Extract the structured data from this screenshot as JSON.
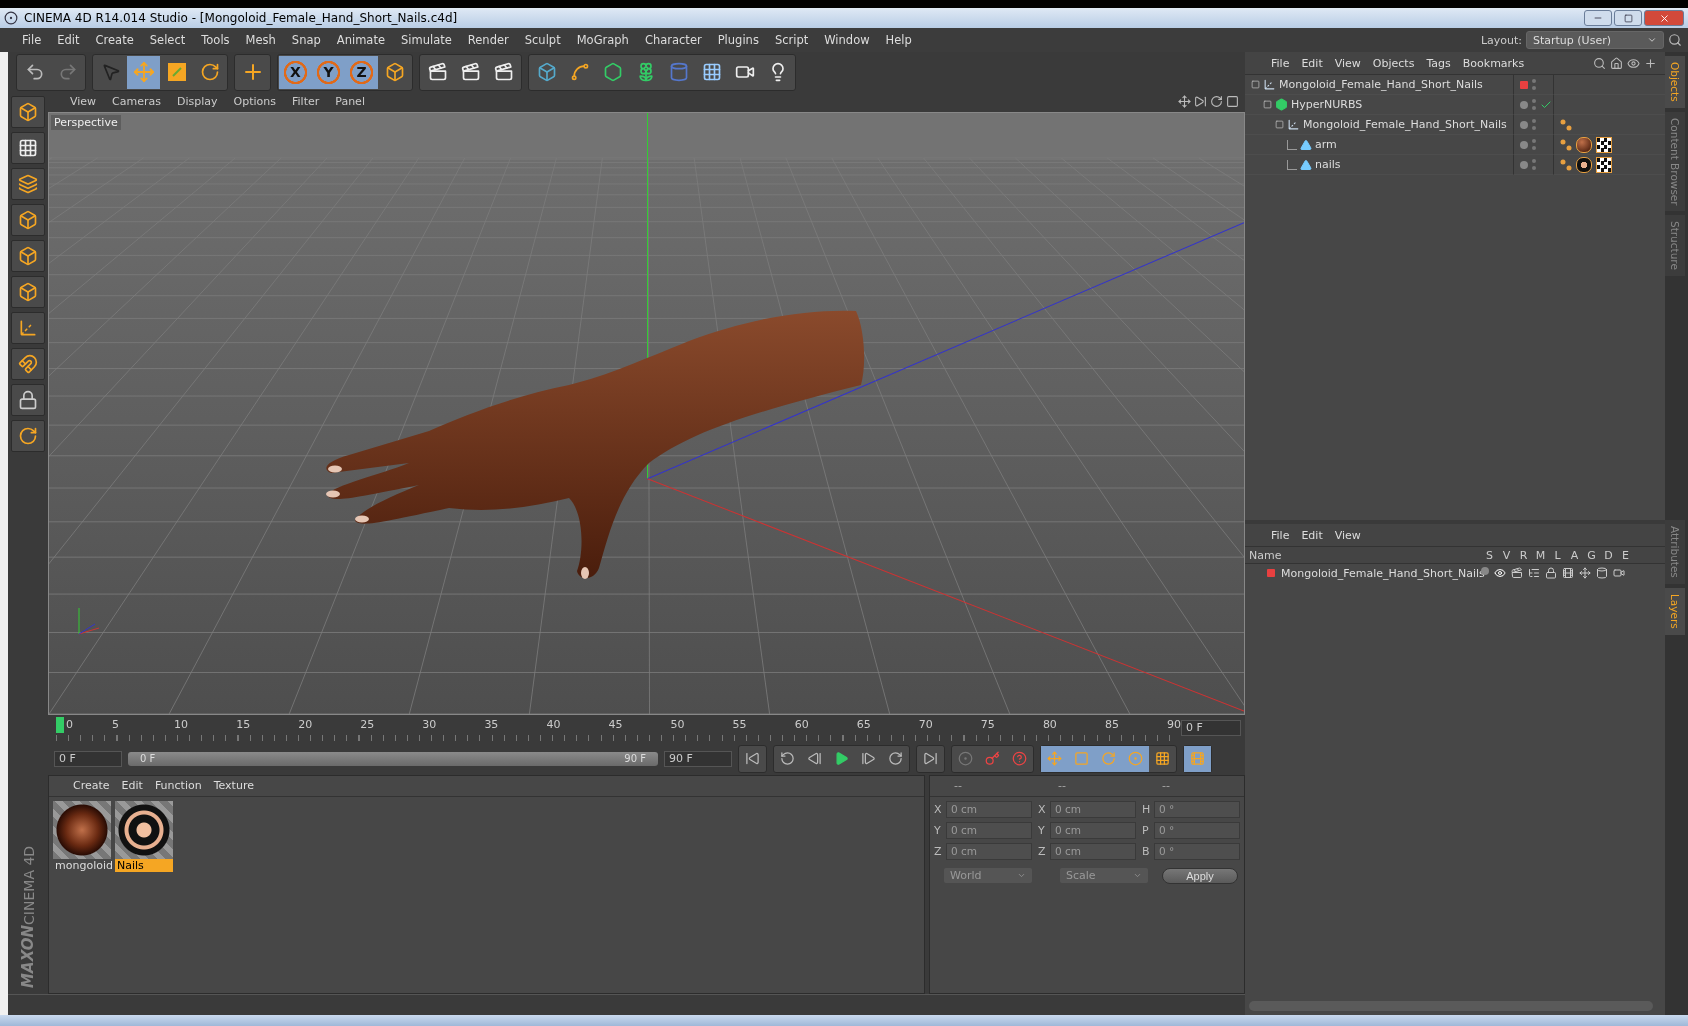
{
  "window": {
    "title": "CINEMA 4D R14.014 Studio - [Mongoloid_Female_Hand_Short_Nails.c4d]"
  },
  "menu": [
    "File",
    "Edit",
    "Create",
    "Select",
    "Tools",
    "Mesh",
    "Snap",
    "Animate",
    "Simulate",
    "Render",
    "Sculpt",
    "MoGraph",
    "Character",
    "Plugins",
    "Script",
    "Window",
    "Help"
  ],
  "layout": {
    "label": "Layout:",
    "value": "Startup (User)"
  },
  "toolbar": {
    "tools": [
      {
        "kind": "select",
        "selected": false
      },
      {
        "kind": "move",
        "selected": true
      },
      {
        "kind": "scale",
        "selected": false
      },
      {
        "kind": "rotate",
        "selected": false
      }
    ],
    "axis_locks": [
      {
        "label": "X",
        "selected": true
      },
      {
        "label": "Y",
        "selected": true
      },
      {
        "label": "Z",
        "selected": true
      }
    ]
  },
  "viewport": {
    "menu": [
      "View",
      "Cameras",
      "Display",
      "Options",
      "Filter",
      "Panel"
    ],
    "label": "Perspective"
  },
  "timeline": {
    "ticks": [
      "0",
      "5",
      "10",
      "15",
      "20",
      "25",
      "30",
      "35",
      "40",
      "45",
      "50",
      "55",
      "60",
      "65",
      "70",
      "75",
      "80",
      "85",
      "90"
    ],
    "frame": "0 F"
  },
  "transport": {
    "start": "0 F",
    "range": {
      "start": "0 F",
      "end": "90 F",
      "level": 1
    },
    "end": "90 F"
  },
  "materials": {
    "menu": [
      "Create",
      "Edit",
      "Function",
      "Texture"
    ],
    "items": [
      {
        "name": "mongoloid",
        "kind": "skin",
        "selected": false
      },
      {
        "name": "Nails",
        "kind": "nails",
        "selected": true
      }
    ]
  },
  "coordinates": {
    "headers": [
      "--",
      "--",
      "--"
    ],
    "rows": [
      {
        "cells": [
          {
            "label": "X",
            "value": "0 cm"
          },
          {
            "label": "X",
            "value": "0 cm"
          },
          {
            "label": "H",
            "value": "0 °"
          }
        ]
      },
      {
        "cells": [
          {
            "label": "Y",
            "value": "0 cm"
          },
          {
            "label": "Y",
            "value": "0 cm"
          },
          {
            "label": "P",
            "value": "0 °"
          }
        ]
      },
      {
        "cells": [
          {
            "label": "Z",
            "value": "0 cm"
          },
          {
            "label": "Z",
            "value": "0 cm"
          },
          {
            "label": "B",
            "value": "0 °"
          }
        ]
      }
    ],
    "modes": [
      "World",
      "Scale"
    ],
    "apply": "Apply"
  },
  "objects": {
    "menu": [
      "File",
      "Edit",
      "View",
      "Objects",
      "Tags",
      "Bookmarks"
    ],
    "tree": [
      {
        "name": "Mongoloid_Female_Hand_Short_Nails",
        "kind": "null",
        "color": "#e84040",
        "children": [
          {
            "name": "HyperNURBS",
            "kind": "nurbs",
            "tags": [
              {
                "kind": "check"
              }
            ],
            "children": [
              {
                "name": "Mongoloid_Female_Hand_Short_Nails",
                "kind": "null",
                "tags": [
                  {
                    "kind": "phong"
                  }
                ],
                "children": [
                  {
                    "name": "arm",
                    "kind": "polygon",
                    "tags": [
                      {
                        "kind": "phong"
                      },
                      {
                        "kind": "skin"
                      },
                      {
                        "kind": "checker"
                      }
                    ]
                  },
                  {
                    "name": "nails",
                    "kind": "polygon",
                    "tags": [
                      {
                        "kind": "phong"
                      },
                      {
                        "kind": "nails"
                      },
                      {
                        "kind": "checker"
                      }
                    ]
                  }
                ]
              }
            ]
          }
        ]
      }
    ]
  },
  "layers": {
    "menu": [
      "File",
      "Edit",
      "View"
    ],
    "columns": [
      "Name",
      "S",
      "V",
      "R",
      "M",
      "L",
      "A",
      "G",
      "D",
      "E"
    ],
    "rows": [
      {
        "name": "Mongoloid_Female_Hand_Short_Nails",
        "color": "#e84040"
      }
    ]
  },
  "side_tabs": {
    "top": [
      {
        "label": "Objects",
        "selected": true
      },
      {
        "label": "Content Browser",
        "selected": false
      },
      {
        "label": "Structure",
        "selected": false
      }
    ],
    "bottom": [
      {
        "label": "Attributes",
        "selected": false
      },
      {
        "label": "Layers",
        "selected": true
      }
    ]
  },
  "logo": {
    "brand": "MAXON",
    "product": "CINEMA 4D"
  }
}
